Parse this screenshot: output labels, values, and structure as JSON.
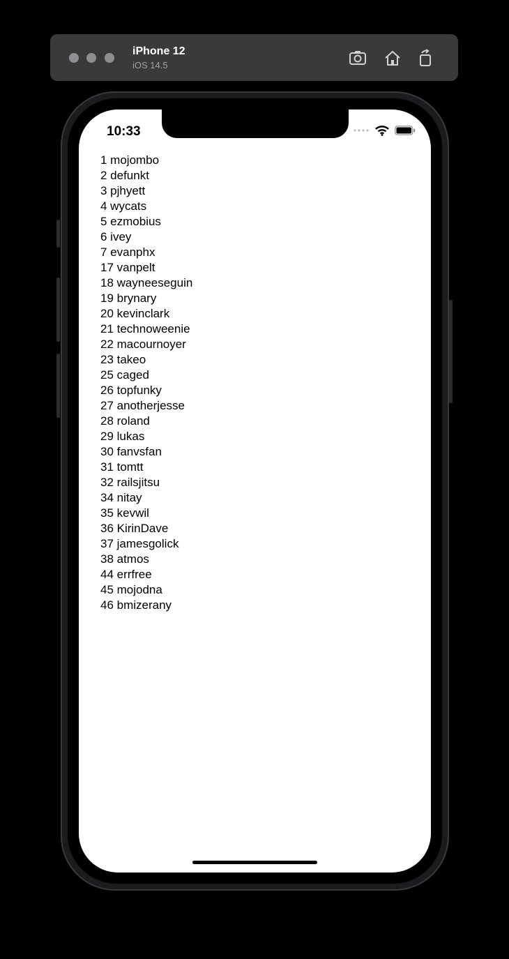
{
  "simulator": {
    "device_name": "iPhone 12",
    "os_version": "iOS 14.5",
    "icons": [
      "screenshot-icon",
      "home-icon",
      "rotate-icon"
    ]
  },
  "status_bar": {
    "time": "10:33"
  },
  "users": [
    "1 mojombo",
    "2 defunkt",
    "3 pjhyett",
    "4 wycats",
    "5 ezmobius",
    "6 ivey",
    "7 evanphx",
    "17 vanpelt",
    "18 wayneeseguin",
    "19 brynary",
    "20 kevinclark",
    "21 technoweenie",
    "22 macournoyer",
    "23 takeo",
    "25 caged",
    "26 topfunky",
    "27 anotherjesse",
    "28 roland",
    "29 lukas",
    "30 fanvsfan",
    "31 tomtt",
    "32 railsjitsu",
    "34 nitay",
    "35 kevwil",
    "36 KirinDave",
    "37 jamesgolick",
    "38 atmos",
    "44 errfree",
    "45 mojodna",
    "46 bmizerany"
  ]
}
